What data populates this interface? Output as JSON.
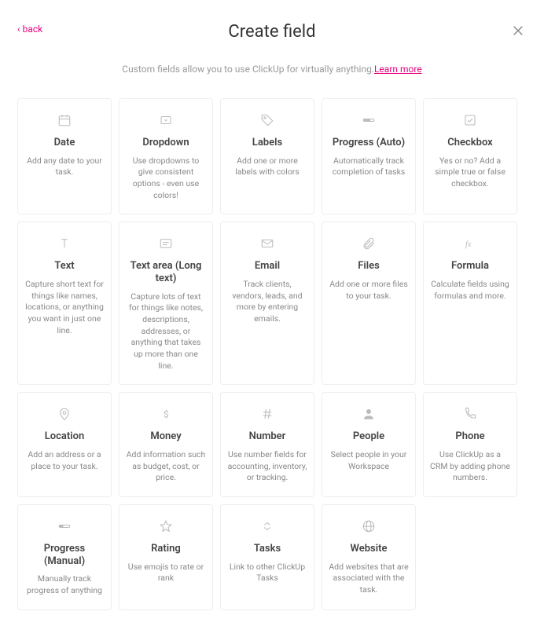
{
  "header": {
    "back_label": "back",
    "title": "Create field",
    "subtitle_plain": "Custom fields allow you to use ClickUp for virtually anything.",
    "learn_more": "Learn more"
  },
  "fields": [
    {
      "key": "date",
      "icon": "calendar-icon",
      "title": "Date",
      "desc": "Add any date to your task."
    },
    {
      "key": "dropdown",
      "icon": "dropdown-icon",
      "title": "Dropdown",
      "desc": "Use dropdowns to give consistent options - even use colors!"
    },
    {
      "key": "labels",
      "icon": "tag-icon",
      "title": "Labels",
      "desc": "Add one or more labels with colors"
    },
    {
      "key": "progress-auto",
      "icon": "progress-icon",
      "title": "Progress (Auto)",
      "desc": "Automatically track completion of tasks"
    },
    {
      "key": "checkbox",
      "icon": "checkbox-icon",
      "title": "Checkbox",
      "desc": "Yes or no? Add a simple true or false checkbox."
    },
    {
      "key": "text",
      "icon": "text-icon",
      "title": "Text",
      "desc": "Capture short text for things like names, locations, or anything you want in just one line."
    },
    {
      "key": "text-area",
      "icon": "textarea-icon",
      "title": "Text area (Long text)",
      "desc": "Capture lots of text for things like notes, descriptions, addresses, or anything that takes up more than one line."
    },
    {
      "key": "email",
      "icon": "mail-icon",
      "title": "Email",
      "desc": "Track clients, vendors, leads, and more by entering emails."
    },
    {
      "key": "files",
      "icon": "attachment-icon",
      "title": "Files",
      "desc": "Add one or more files to your task."
    },
    {
      "key": "formula",
      "icon": "formula-icon",
      "title": "Formula",
      "desc": "Calculate fields using formulas and more."
    },
    {
      "key": "location",
      "icon": "location-icon",
      "title": "Location",
      "desc": "Add an address or a place to your task."
    },
    {
      "key": "money",
      "icon": "money-icon",
      "title": "Money",
      "desc": "Add information such as budget, cost, or price."
    },
    {
      "key": "number",
      "icon": "hash-icon",
      "title": "Number",
      "desc": "Use number fields for accounting, inventory, or tracking."
    },
    {
      "key": "people",
      "icon": "person-icon",
      "title": "People",
      "desc": "Select people in your Workspace"
    },
    {
      "key": "phone",
      "icon": "phone-icon",
      "title": "Phone",
      "desc": "Use ClickUp as a CRM by adding phone numbers."
    },
    {
      "key": "progress-manual",
      "icon": "progress-bar-icon",
      "title": "Progress (Manual)",
      "desc": "Manually track progress of anything"
    },
    {
      "key": "rating",
      "icon": "star-icon",
      "title": "Rating",
      "desc": "Use emojis to rate or rank"
    },
    {
      "key": "tasks",
      "icon": "tasks-icon",
      "title": "Tasks",
      "desc": "Link to other ClickUp Tasks"
    },
    {
      "key": "website",
      "icon": "globe-icon",
      "title": "Website",
      "desc": "Add websites that are associated with the task."
    }
  ]
}
